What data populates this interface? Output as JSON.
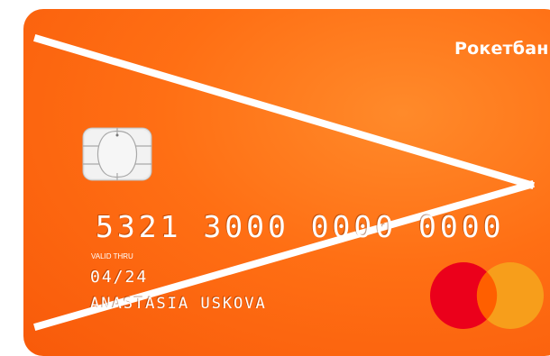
{
  "card": {
    "bank_name": "Рокетбанк",
    "number": "5321 3000 0000 0000",
    "valid_thru_label": "VALID THRU",
    "expiry": "04/24",
    "holder_name": "ANASTASIA USKOVA",
    "background_color": "#ff6f14",
    "network_logo": "mastercard-logo-icon",
    "chip_icon": "emv-chip-icon",
    "colors": {
      "mastercard_red": "#eb001b",
      "mastercard_orange": "#f79e1b",
      "mastercard_overlap": "#ff5f00"
    }
  }
}
